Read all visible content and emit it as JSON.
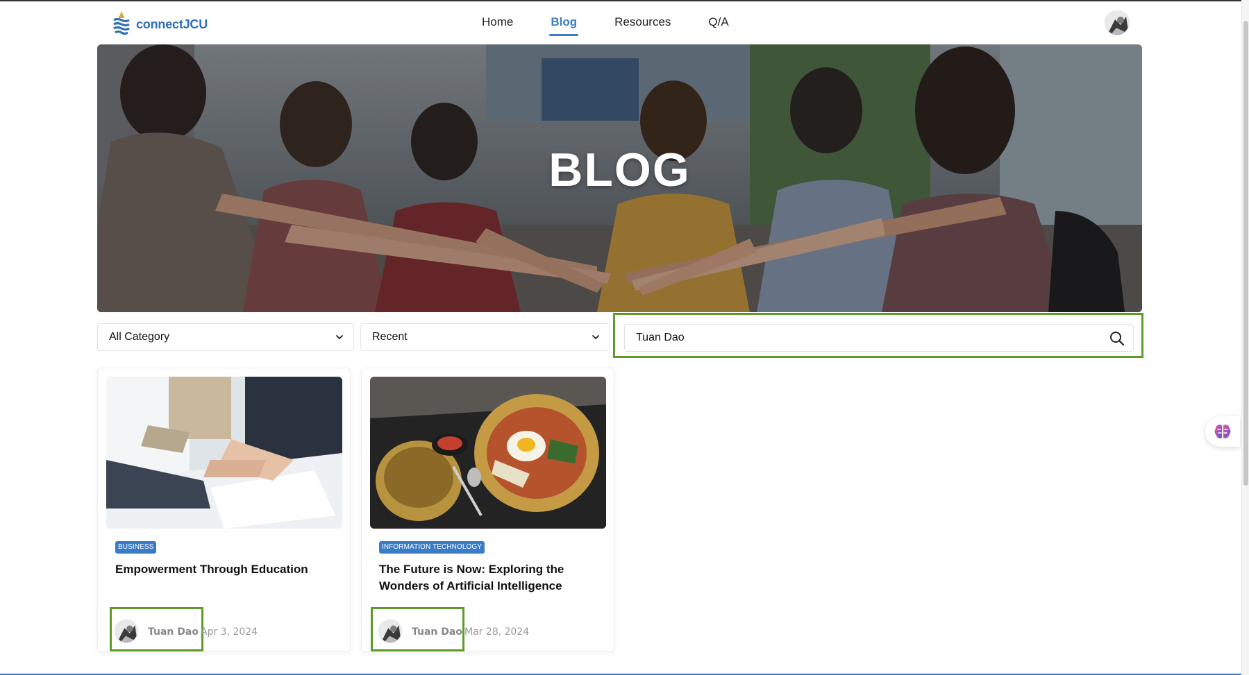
{
  "brand": {
    "name": "connectJCU",
    "accent": "#3a7cc6",
    "highlight": "#5d9c2a"
  },
  "nav": {
    "items": [
      {
        "label": "Home",
        "active": false
      },
      {
        "label": "Blog",
        "active": true
      },
      {
        "label": "Resources",
        "active": false
      },
      {
        "label": "Q/A",
        "active": false
      }
    ]
  },
  "header": {
    "avatar_icon": "user-avatar-icon"
  },
  "hero": {
    "title": "BLOG"
  },
  "filters": {
    "category": {
      "value": "All Category",
      "icon": "chevron-down-icon"
    },
    "sort": {
      "value": "Recent",
      "icon": "chevron-down-icon"
    },
    "search": {
      "value": "Tuan Dao",
      "icon": "search-icon"
    }
  },
  "posts": [
    {
      "category": "BUSINESS",
      "title": "Empowerment Through Education",
      "author": "Tuan Dao",
      "date": "Apr 3, 2024"
    },
    {
      "category": "INFORMATION TECHNOLOGY",
      "title": "The Future is Now: Exploring the Wonders of Artificial Intelligence",
      "author": "Tuan Dao",
      "date": "Mar 28, 2024"
    }
  ],
  "floating": {
    "icon": "brain-icon"
  }
}
